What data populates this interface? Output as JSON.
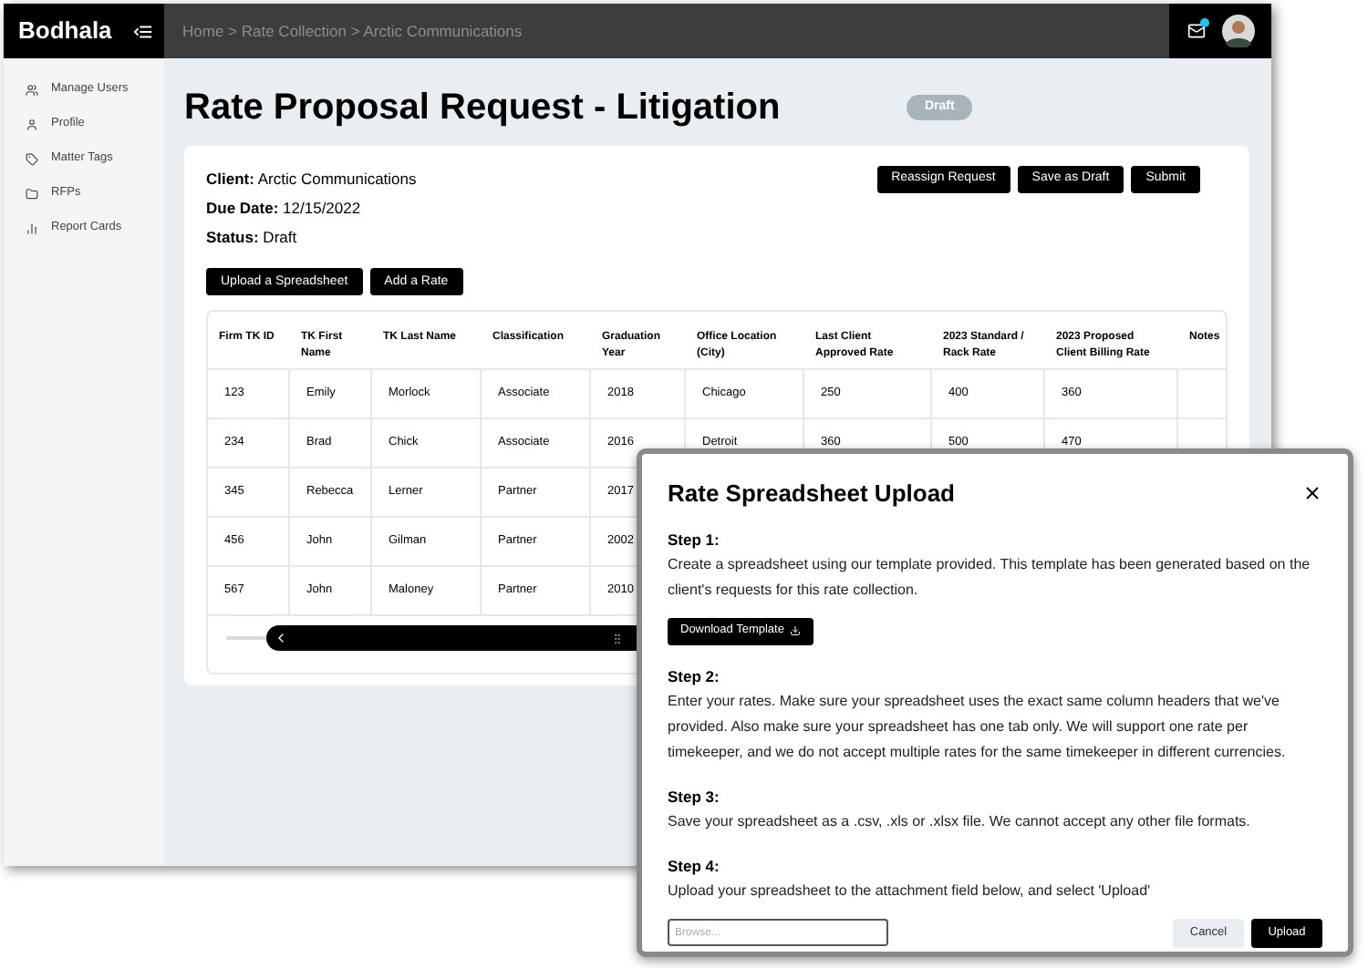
{
  "app": {
    "logo": "Bodhala",
    "breadcrumb": "Home > Rate Collection > Arctic Communications"
  },
  "sidebar": {
    "items": [
      {
        "label": "Manage Users"
      },
      {
        "label": "Profile"
      },
      {
        "label": "Matter Tags"
      },
      {
        "label": "RFPs"
      },
      {
        "label": "Report Cards"
      }
    ]
  },
  "page": {
    "title": "Rate Proposal Request - Litigation",
    "status_badge": "Draft"
  },
  "details": [
    "**Client:** Arctic Communications",
    "**Due Date:** 12/15/2022",
    "**Status:** Draft"
  ],
  "header_buttons": [
    "Reassign Request",
    "Save as Draft",
    "Submit"
  ],
  "actions": [
    "Upload a Spreadsheet",
    "Add a Rate"
  ],
  "table": {
    "columns": [
      "Firm TK ID",
      "TK First Name",
      "TK Last Name",
      "Classification",
      "Graduation Year",
      "Office Location (City)",
      "Last Client Approved Rate",
      "2023 Standard / Rack Rate",
      "2023 Proposed Client Billing Rate",
      "Notes"
    ],
    "rows": [
      [
        "123",
        "Emily",
        "Morlock",
        "Associate",
        "2018",
        "Chicago",
        "250",
        "400",
        "360",
        ""
      ],
      [
        "234",
        "Brad",
        "Chick",
        "Associate",
        "2016",
        "Detroit",
        "360",
        "500",
        "470",
        ""
      ],
      [
        "345",
        "Rebecca",
        "Lerner",
        "Partner",
        "2017"
      ],
      [
        "456",
        "John",
        "Gilman",
        "Partner",
        "2002"
      ],
      [
        "567",
        "John",
        "Maloney",
        "Partner",
        "2010"
      ]
    ]
  },
  "modal": {
    "title": "Rate Spreadsheet Upload",
    "steps": [
      {
        "heading": "Step 1:",
        "text": "Create a spreadsheet using our template provided. This template has been generated based on the client's requests for this rate collection.",
        "button": "Download Template"
      },
      {
        "heading": "Step 2:",
        "text": "Enter your rates. Make sure your spreadsheet uses the exact same column headers that we've provided. Also make sure your spreadsheet has one tab only. We will support one rate per timekeeper, and we do not accept multiple rates for the same timekeeper in different currencies."
      },
      {
        "heading": "Step 3:",
        "text": "Save your spreadsheet as a .csv, .xls or .xlsx file. We cannot accept any other file formats."
      },
      {
        "heading": "Step 4:",
        "text": "Upload your spreadsheet to the attachment field below, and select 'Upload'"
      }
    ],
    "file_field": {
      "placeholder": "Browse..."
    },
    "buttons": [
      {
        "label": "Cancel",
        "kind": "secondary"
      },
      {
        "label": "Upload",
        "kind": "primary"
      }
    ]
  }
}
